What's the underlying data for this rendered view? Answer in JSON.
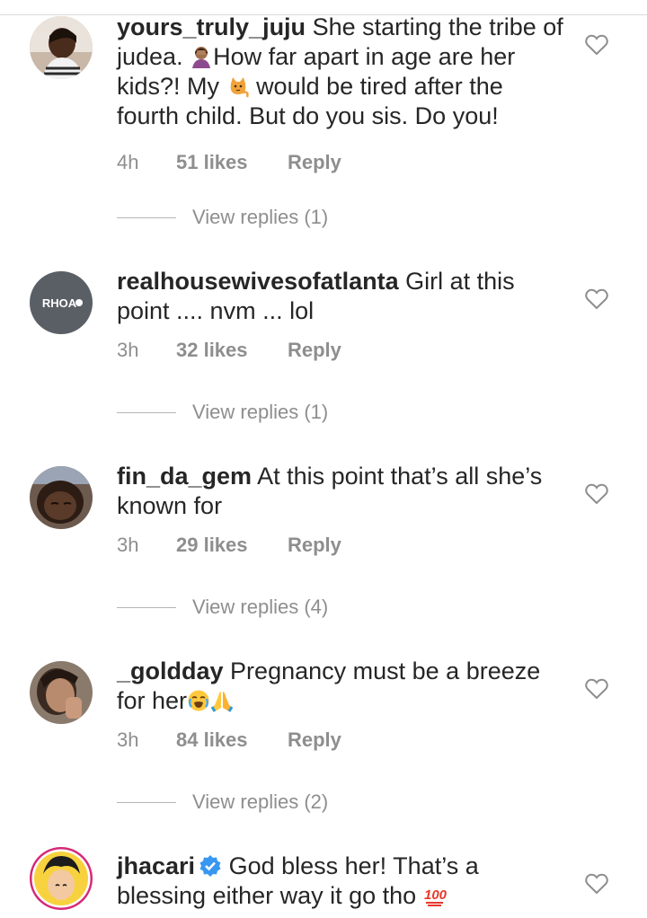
{
  "comments": [
    {
      "username": "yours_truly_juju",
      "text_lines": [
        "She starting the tribe of",
        "judea.",
        "How far apart in age are her",
        "kids?! My",
        "would be tired after the",
        "fourth child. But do you sis. Do you!"
      ],
      "emojis": [
        "facepalm-emoji",
        "cat-emoji"
      ],
      "time": "4h",
      "likes": "51 likes",
      "reply": "Reply",
      "view_replies": "View replies (1)"
    },
    {
      "username": "realhousewivesofatlanta",
      "avatar_text": "RHOA",
      "text_lines": [
        "Girl at this",
        "point .... nvm ... lol"
      ],
      "time": "3h",
      "likes": "32 likes",
      "reply": "Reply",
      "view_replies": "View replies (1)"
    },
    {
      "username": "fin_da_gem",
      "text_lines": [
        "At this point that’s all she’s",
        "known for"
      ],
      "time": "3h",
      "likes": "29 likes",
      "reply": "Reply",
      "view_replies": "View replies (4)"
    },
    {
      "username": "_goldday",
      "text_lines": [
        "Pregnancy must be a breeze",
        "for her"
      ],
      "emojis": [
        "crying-face-emoji",
        "praying-hands-emoji"
      ],
      "time": "3h",
      "likes": "84 likes",
      "reply": "Reply",
      "view_replies": "View replies (2)"
    },
    {
      "username": "jhacari",
      "verified": true,
      "text_lines": [
        "God bless her! That’s a",
        "blessing either way it go tho"
      ],
      "emojis": [
        "hundred-points-emoji"
      ]
    }
  ],
  "colors": {
    "text": "#262626",
    "meta": "#8e8e8e",
    "verified": "#3897f0"
  }
}
